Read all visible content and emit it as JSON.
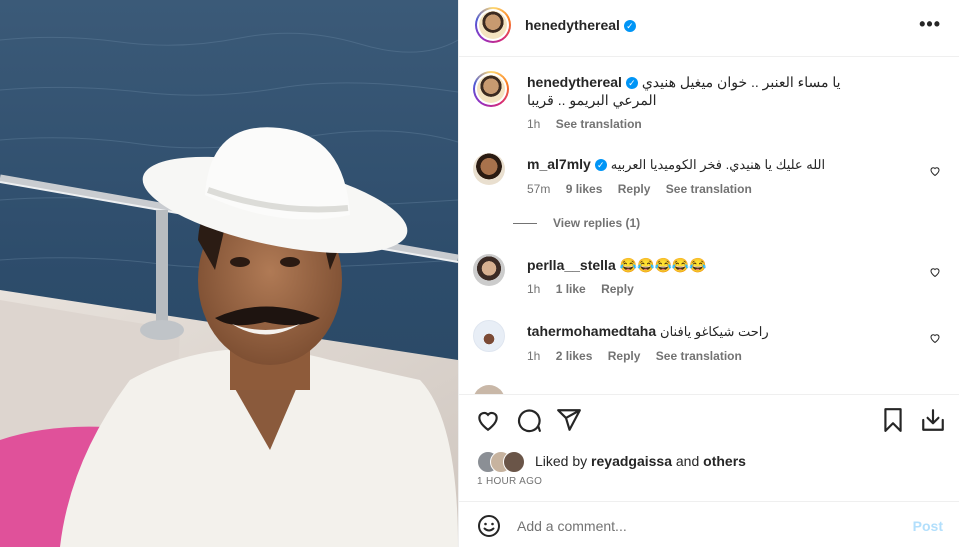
{
  "post": {
    "author": "henedythereal",
    "caption_line1": "يا مساء العنبر .. خوان ميغيل هنيدي",
    "caption_line2": "المرعي البريمو .. قريبا",
    "caption_time": "1h",
    "see_translation": "See translation",
    "more_icon": "more-horizontal-icon",
    "verified_icon": "verified-badge-icon"
  },
  "comments": [
    {
      "user": "m_al7mly",
      "verified": true,
      "text": "الله عليك يا هنيدي. فخر الكوميديا العربيه",
      "time": "57m",
      "likes": "9 likes",
      "reply": "Reply",
      "translate": "See translation",
      "view_replies": "View replies (1)"
    },
    {
      "user": "perlla__stella",
      "verified": false,
      "text": "😂😂😂😂😂",
      "time": "1h",
      "likes": "1 like",
      "reply": "Reply"
    },
    {
      "user": "tahermohamedtaha",
      "verified": false,
      "text": "راحت شيكاغو يافنان",
      "time": "1h",
      "likes": "2 likes",
      "reply": "Reply",
      "translate": "See translation"
    }
  ],
  "actions": {
    "like_icon": "heart-icon",
    "comment_icon": "comment-icon",
    "share_icon": "share-icon",
    "save_icon": "bookmark-icon",
    "download_icon": "download-icon"
  },
  "likes": {
    "prefix": "Liked by",
    "user": "reyadgaissa",
    "middle": "and",
    "suffix": "others"
  },
  "posted_ago": "1 HOUR AGO",
  "add_comment": {
    "placeholder": "Add a comment...",
    "post_label": "Post",
    "emoji_icon": "emoji-icon"
  },
  "colors": {
    "link_blue": "#0095f6",
    "post_disabled": "#b2dffc",
    "muted": "#737373"
  }
}
